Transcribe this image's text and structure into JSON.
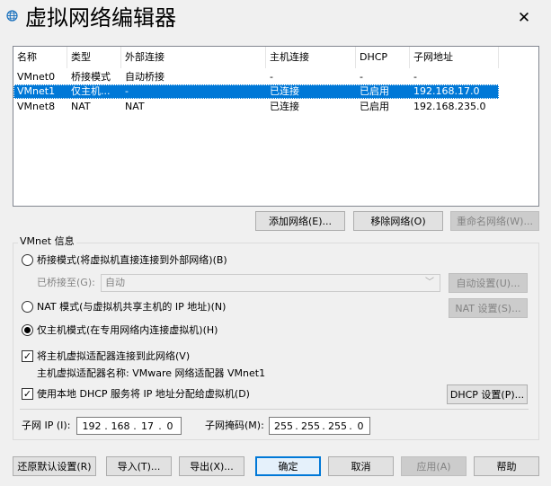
{
  "window": {
    "title": "虚拟网络编辑器",
    "close_symbol": "✕"
  },
  "network_list": {
    "columns": [
      "名称",
      "类型",
      "外部连接",
      "主机连接",
      "DHCP",
      "子网地址"
    ],
    "rows": [
      {
        "name": "VMnet0",
        "type": "桥接模式",
        "external": "自动桥接",
        "host": "-",
        "dhcp": "-",
        "subnet": "-",
        "selected": false
      },
      {
        "name": "VMnet1",
        "type": "仅主机...",
        "external": "-",
        "host": "已连接",
        "dhcp": "已启用",
        "subnet": "192.168.17.0",
        "selected": true
      },
      {
        "name": "VMnet8",
        "type": "NAT",
        "external": "NAT",
        "host": "已连接",
        "dhcp": "已启用",
        "subnet": "192.168.235.0",
        "selected": false
      }
    ]
  },
  "list_buttons": {
    "add": "添加网络(E)...",
    "remove": "移除网络(O)",
    "rename": "重命名网络(W)..."
  },
  "vmnet_info": {
    "legend": "VMnet 信息",
    "bridged_label": "桥接模式(将虚拟机直接连接到外部网络)(B)",
    "bridged_to_label": "已桥接至(G):",
    "bridged_to_value": "自动",
    "auto_settings": "自动设置(U)...",
    "nat_label": "NAT 模式(与虚拟机共享主机的 IP 地址)(N)",
    "nat_settings": "NAT 设置(S)...",
    "hostonly_label": "仅主机模式(在专用网络内连接虚拟机)(H)",
    "connect_adapter_label": "将主机虚拟适配器连接到此网络(V)",
    "adapter_name_label": "主机虚拟适配器名称: VMware 网络适配器 VMnet1",
    "dhcp_label": "使用本地 DHCP 服务将 IP 地址分配给虚拟机(D)",
    "dhcp_settings": "DHCP 设置(P)...",
    "subnet_ip_label": "子网 IP (I):",
    "subnet_ip": [
      "192",
      "168",
      "17",
      "0"
    ],
    "subnet_mask_label": "子网掩码(M):",
    "subnet_mask": [
      "255",
      "255",
      "255",
      "0"
    ]
  },
  "footer": {
    "restore": "还原默认设置(R)",
    "import": "导入(T)...",
    "export": "导出(X)...",
    "ok": "确定",
    "cancel": "取消",
    "apply": "应用(A)",
    "help": "帮助"
  },
  "colors": {
    "selection": "#0078d7",
    "icon_blue": "#1e73be"
  }
}
